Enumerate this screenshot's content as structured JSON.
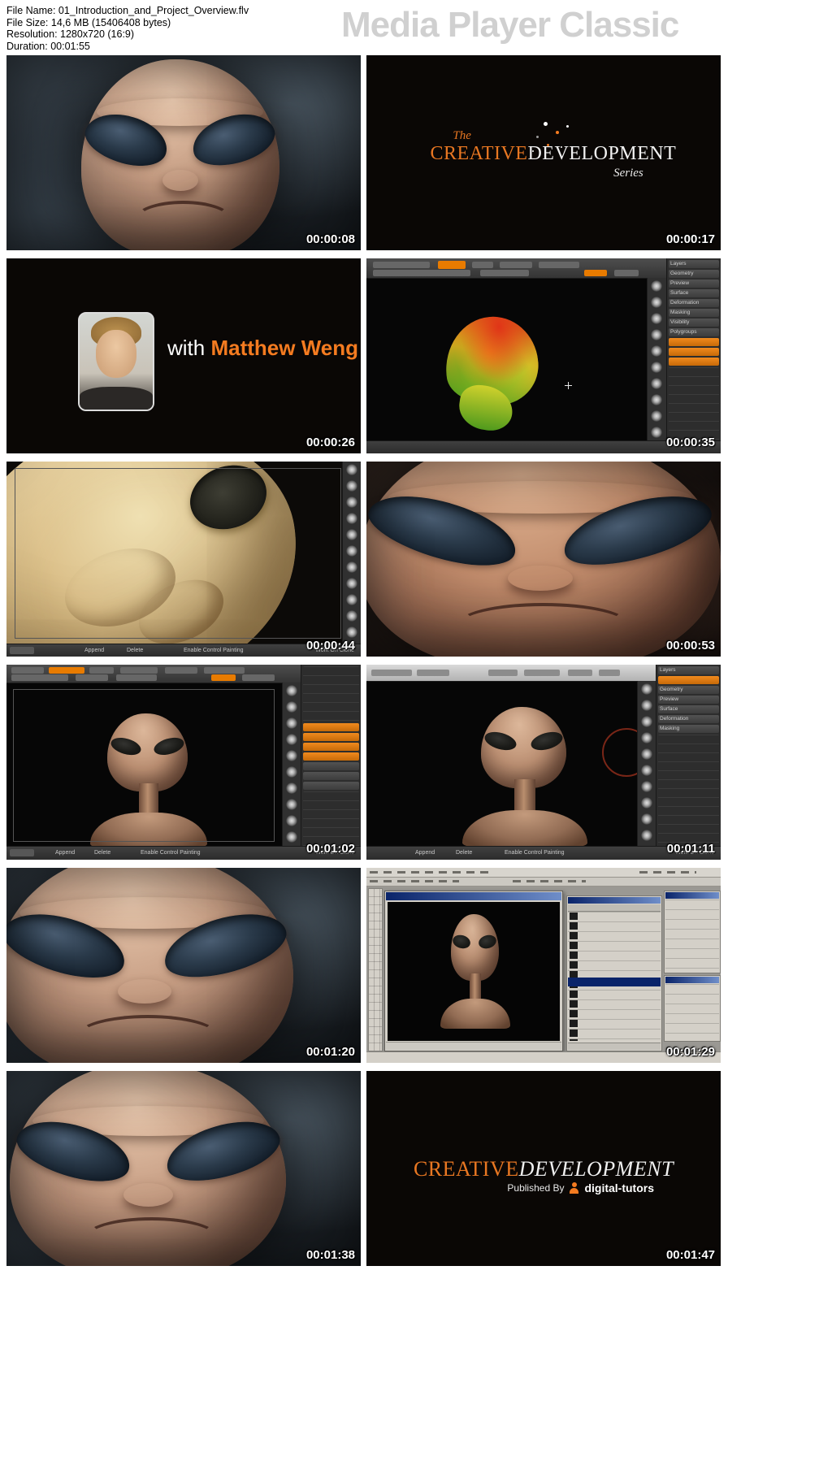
{
  "colors": {
    "accent_orange": "#f47b20",
    "zbrush_orange": "#e87b00",
    "watermark_gray": "#d0d0d0",
    "timestamp_white": "#ffffff",
    "selection_blue": "#0a246a"
  },
  "header": {
    "file_name": "File Name: 01_Introduction_and_Project_Overview.flv",
    "file_size": "File Size: 14,6 MB (15406408 bytes)",
    "resolution": "Resolution: 1280x720 (16:9)",
    "duration": "Duration: 00:01:55",
    "watermark": "Media Player Classic"
  },
  "title_card": {
    "the": "The",
    "creative": "CREATIVE",
    "development": "DEVELOPMENT",
    "series": "Series"
  },
  "presenter": {
    "with": "with",
    "name": "Matthew Weng"
  },
  "credits": {
    "creative": "CREATIVE",
    "development": "DEVELOPMENT",
    "published_by": "Published By",
    "brand": "digital-tutors"
  },
  "zbrush": {
    "palette": [
      "Layers",
      "Geometry",
      "Preview",
      "Surface",
      "Deformation",
      "Masking",
      "Visibility",
      "Polygroups"
    ],
    "bottom_bar": {
      "append": "Append",
      "delete": "Delete",
      "enable_control_painting": "Enable Control Painting",
      "work_on_clone": "Work On Clone"
    }
  },
  "thumbnails": [
    {
      "timestamp": "00:00:08"
    },
    {
      "timestamp": "00:00:17"
    },
    {
      "timestamp": "00:00:26"
    },
    {
      "timestamp": "00:00:35"
    },
    {
      "timestamp": "00:00:44"
    },
    {
      "timestamp": "00:00:53"
    },
    {
      "timestamp": "00:01:02"
    },
    {
      "timestamp": "00:01:11"
    },
    {
      "timestamp": "00:01:20"
    },
    {
      "timestamp": "00:01:29"
    },
    {
      "timestamp": "00:01:38"
    },
    {
      "timestamp": "00:01:47"
    }
  ]
}
